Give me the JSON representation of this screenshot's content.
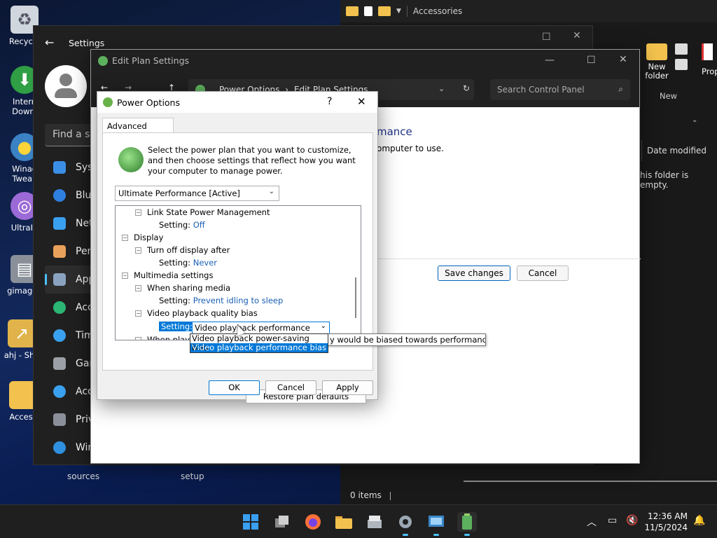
{
  "desktop": {
    "icons": [
      {
        "label": "Recycle",
        "icon": "recycle-bin-icon"
      },
      {
        "label": "Intern Downl",
        "icon": "internet-download-icon"
      },
      {
        "label": "Winae Tweak",
        "icon": "winaero-tweaker-icon"
      },
      {
        "label": "UltraIS",
        "icon": "ultraiso-icon"
      },
      {
        "label": "gimagex",
        "icon": "gimagex-icon"
      },
      {
        "label": "ahj - Sho",
        "icon": "shortcut-folder-icon"
      },
      {
        "label": "Access",
        "icon": "folder-icon"
      }
    ],
    "bottom_labels": [
      "sources",
      "setup"
    ]
  },
  "explorer": {
    "title": "Accessories",
    "ribbon_new_folder": "New folder",
    "ribbon_props": "Prop",
    "ribbon_group": "New",
    "column_date": "Date modified",
    "empty_text": "his folder is empty.",
    "status_items": "0 items"
  },
  "settings": {
    "title": "Settings",
    "search_placeholder": "Find a se",
    "nav": [
      {
        "label": "Syst",
        "icon": "system-icon",
        "color": "#3a8ee6"
      },
      {
        "label": "Blue",
        "icon": "bluetooth-icon",
        "color": "#2f7fe0"
      },
      {
        "label": "Net",
        "icon": "network-icon",
        "color": "#3aa0f0"
      },
      {
        "label": "Pers",
        "icon": "brush-icon",
        "color": "#e8a15a"
      },
      {
        "label": "Apps",
        "icon": "apps-icon",
        "color": "#8aa2c0"
      },
      {
        "label": "Acco",
        "icon": "account-icon",
        "color": "#2bb673"
      },
      {
        "label": "Tim",
        "icon": "time-icon",
        "color": "#3aa0f0"
      },
      {
        "label": "Gam",
        "icon": "gaming-icon",
        "color": "#9aa0a6"
      },
      {
        "label": "Acc",
        "icon": "accessibility-icon",
        "color": "#3aa0f0"
      },
      {
        "label": "Priv",
        "icon": "shield-icon",
        "color": "#8a8f99"
      },
      {
        "label": "Win",
        "icon": "update-icon",
        "color": "#2f8fe0"
      }
    ]
  },
  "editplan": {
    "title": "Edit Plan Settings",
    "path_root": "Power Options",
    "path_sep": "›",
    "path_leaf": "Edit Plan Settings",
    "search_placeholder": "Search Control Panel",
    "heading_fragment": "mance",
    "sub_fragment": "omputer to use.",
    "save_label": "Save changes",
    "cancel_label": "Cancel"
  },
  "power_options": {
    "title": "Power Options",
    "help": "?",
    "tab": "Advanced settings",
    "description": "Select the power plan that you want to customize, and then choose settings that reflect how you want your computer to manage power.",
    "plan_selected": "Ultimate Performance [Active]",
    "tree": [
      {
        "kind": "node",
        "level": 1,
        "label": "Link State Power Management"
      },
      {
        "kind": "setting",
        "level": 2,
        "prefix": "Setting:",
        "value": "Off"
      },
      {
        "kind": "node",
        "level": 0,
        "label": "Display"
      },
      {
        "kind": "node",
        "level": 1,
        "label": "Turn off display after"
      },
      {
        "kind": "setting",
        "level": 2,
        "prefix": "Setting:",
        "value": "Never"
      },
      {
        "kind": "node",
        "level": 0,
        "label": "Multimedia settings"
      },
      {
        "kind": "node",
        "level": 1,
        "label": "When sharing media"
      },
      {
        "kind": "setting",
        "level": 2,
        "prefix": "Setting:",
        "value": "Prevent idling to sleep"
      },
      {
        "kind": "node",
        "level": 1,
        "label": "Video playback quality bias"
      }
    ],
    "active_setting_prefix": "Setting:",
    "combo_value": "Video playback performance bias",
    "combo_options": [
      "Video playback power-saving bias",
      "Video playback performance bias"
    ],
    "partial_row": "When playi",
    "tooltip": "y would be biased towards performance.",
    "restore_label": "Restore plan defaults",
    "ok_label": "OK",
    "cancel_label": "Cancel",
    "apply_label": "Apply"
  },
  "taskbar": {
    "time": "12:36 AM",
    "date": "11/5/2024",
    "apps": [
      "start-icon",
      "task-view-icon",
      "firefox-icon",
      "file-explorer-icon",
      "disk-tool-icon",
      "settings-icon",
      "control-panel-icon",
      "power-options-icon"
    ]
  }
}
